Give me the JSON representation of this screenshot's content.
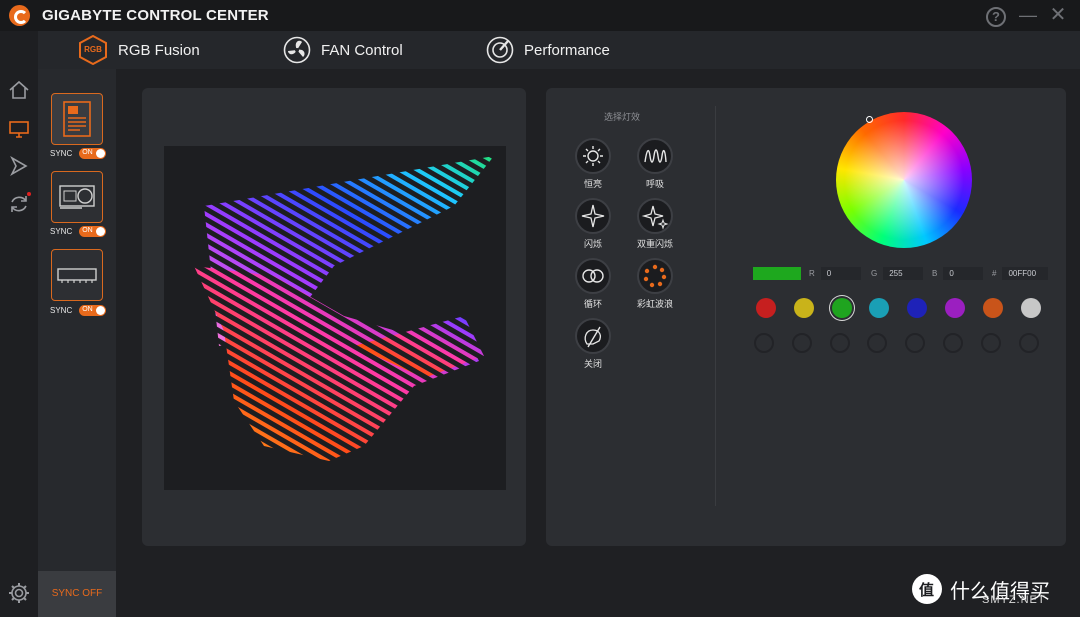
{
  "app": {
    "title": "GIGABYTE CONTROL CENTER"
  },
  "window": {
    "help": "?",
    "minimize": "—",
    "close": "✕"
  },
  "tabs": [
    {
      "label": "RGB Fusion",
      "icon": "rgb-fusion-icon",
      "badge": "RGB"
    },
    {
      "label": "FAN Control",
      "icon": "fan-icon"
    },
    {
      "label": "Performance",
      "icon": "performance-gauge-icon"
    }
  ],
  "rail": [
    {
      "icon": "home-icon"
    },
    {
      "icon": "monitor-icon"
    },
    {
      "icon": "arrow-forward-icon"
    },
    {
      "icon": "sync-update-icon"
    },
    {
      "icon": "gear-icon"
    }
  ],
  "devices": [
    {
      "name": "motherboard",
      "sync_label": "SYNC",
      "toggle": "ON"
    },
    {
      "name": "graphics-card",
      "sync_label": "SYNC",
      "toggle": "ON"
    },
    {
      "name": "memory",
      "sync_label": "SYNC",
      "toggle": "ON"
    }
  ],
  "sync_off": "SYNC OFF",
  "effects": {
    "title": "选择灯效",
    "items": [
      {
        "label": "恒亮",
        "icon": "sun-icon"
      },
      {
        "label": "呼吸",
        "icon": "wave-icon"
      },
      {
        "label": "闪烁",
        "icon": "sparkle-icon"
      },
      {
        "label": "双重闪烁",
        "icon": "double-sparkle-icon"
      },
      {
        "label": "循环",
        "icon": "cycle-icon"
      },
      {
        "label": "彩虹波浪",
        "icon": "rainbow-dots-icon"
      },
      {
        "label": "关闭",
        "icon": "off-icon"
      }
    ]
  },
  "color": {
    "current": "#1ea81e",
    "r_label": "R",
    "r_value": "0",
    "g_label": "G",
    "g_value": "255",
    "b_label": "B",
    "b_value": "0",
    "hex_label": "#",
    "hex_value": "00FF00",
    "swatches": [
      "#c61f1f",
      "#c9b31a",
      "#1fa41f",
      "#1a9fb5",
      "#1e22b8",
      "#9b1fc0",
      "#c9541a",
      "#c7c7c7"
    ]
  },
  "watermark": {
    "text": "什么值得买",
    "sub": "SMYZ.NET"
  }
}
